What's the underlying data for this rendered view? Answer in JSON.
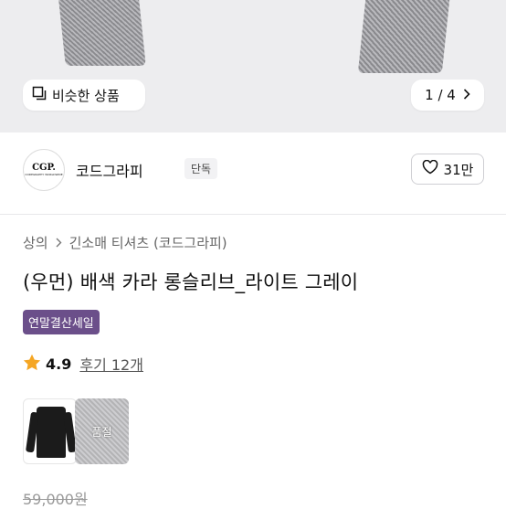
{
  "gallery": {
    "similar_label": "비슷한 상품",
    "counter": "1 / 4"
  },
  "brand": {
    "logo_text": "CGP.",
    "logo_subtext": "CODEGRAPHY WORLDWIDE",
    "name": "코드그라피",
    "badge": "단독",
    "likes": "31만"
  },
  "breadcrumb": [
    "상의",
    "긴소매 티셔츠 (코드그라피)"
  ],
  "product": {
    "title": "(우먼) 배색 카라 롱슬리브_라이트 그레이",
    "sale_badge": "연말결산세일",
    "rating": "4.9",
    "review_label": "후기 12개",
    "soldout_label": "품절",
    "price": "59,000원"
  },
  "colors": {
    "sale_badge": "#6b4f8a",
    "star": "#f5a623"
  }
}
